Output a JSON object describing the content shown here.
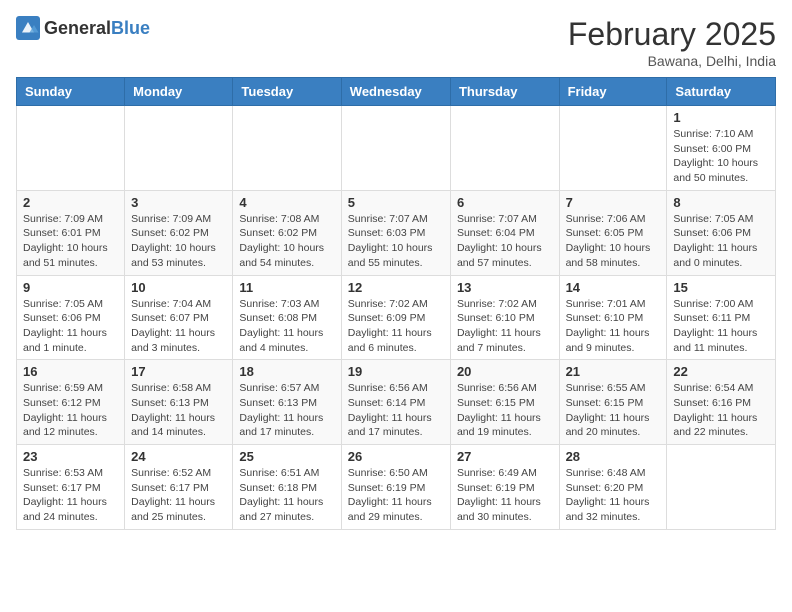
{
  "header": {
    "logo_general": "General",
    "logo_blue": "Blue",
    "month_title": "February 2025",
    "location": "Bawana, Delhi, India"
  },
  "weekdays": [
    "Sunday",
    "Monday",
    "Tuesday",
    "Wednesday",
    "Thursday",
    "Friday",
    "Saturday"
  ],
  "weeks": [
    [
      {
        "day": "",
        "info": ""
      },
      {
        "day": "",
        "info": ""
      },
      {
        "day": "",
        "info": ""
      },
      {
        "day": "",
        "info": ""
      },
      {
        "day": "",
        "info": ""
      },
      {
        "day": "",
        "info": ""
      },
      {
        "day": "1",
        "info": "Sunrise: 7:10 AM\nSunset: 6:00 PM\nDaylight: 10 hours and 50 minutes."
      }
    ],
    [
      {
        "day": "2",
        "info": "Sunrise: 7:09 AM\nSunset: 6:01 PM\nDaylight: 10 hours and 51 minutes."
      },
      {
        "day": "3",
        "info": "Sunrise: 7:09 AM\nSunset: 6:02 PM\nDaylight: 10 hours and 53 minutes."
      },
      {
        "day": "4",
        "info": "Sunrise: 7:08 AM\nSunset: 6:02 PM\nDaylight: 10 hours and 54 minutes."
      },
      {
        "day": "5",
        "info": "Sunrise: 7:07 AM\nSunset: 6:03 PM\nDaylight: 10 hours and 55 minutes."
      },
      {
        "day": "6",
        "info": "Sunrise: 7:07 AM\nSunset: 6:04 PM\nDaylight: 10 hours and 57 minutes."
      },
      {
        "day": "7",
        "info": "Sunrise: 7:06 AM\nSunset: 6:05 PM\nDaylight: 10 hours and 58 minutes."
      },
      {
        "day": "8",
        "info": "Sunrise: 7:05 AM\nSunset: 6:06 PM\nDaylight: 11 hours and 0 minutes."
      }
    ],
    [
      {
        "day": "9",
        "info": "Sunrise: 7:05 AM\nSunset: 6:06 PM\nDaylight: 11 hours and 1 minute."
      },
      {
        "day": "10",
        "info": "Sunrise: 7:04 AM\nSunset: 6:07 PM\nDaylight: 11 hours and 3 minutes."
      },
      {
        "day": "11",
        "info": "Sunrise: 7:03 AM\nSunset: 6:08 PM\nDaylight: 11 hours and 4 minutes."
      },
      {
        "day": "12",
        "info": "Sunrise: 7:02 AM\nSunset: 6:09 PM\nDaylight: 11 hours and 6 minutes."
      },
      {
        "day": "13",
        "info": "Sunrise: 7:02 AM\nSunset: 6:10 PM\nDaylight: 11 hours and 7 minutes."
      },
      {
        "day": "14",
        "info": "Sunrise: 7:01 AM\nSunset: 6:10 PM\nDaylight: 11 hours and 9 minutes."
      },
      {
        "day": "15",
        "info": "Sunrise: 7:00 AM\nSunset: 6:11 PM\nDaylight: 11 hours and 11 minutes."
      }
    ],
    [
      {
        "day": "16",
        "info": "Sunrise: 6:59 AM\nSunset: 6:12 PM\nDaylight: 11 hours and 12 minutes."
      },
      {
        "day": "17",
        "info": "Sunrise: 6:58 AM\nSunset: 6:13 PM\nDaylight: 11 hours and 14 minutes."
      },
      {
        "day": "18",
        "info": "Sunrise: 6:57 AM\nSunset: 6:13 PM\nDaylight: 11 hours and 17 minutes."
      },
      {
        "day": "19",
        "info": "Sunrise: 6:56 AM\nSunset: 6:14 PM\nDaylight: 11 hours and 17 minutes."
      },
      {
        "day": "20",
        "info": "Sunrise: 6:56 AM\nSunset: 6:15 PM\nDaylight: 11 hours and 19 minutes."
      },
      {
        "day": "21",
        "info": "Sunrise: 6:55 AM\nSunset: 6:15 PM\nDaylight: 11 hours and 20 minutes."
      },
      {
        "day": "22",
        "info": "Sunrise: 6:54 AM\nSunset: 6:16 PM\nDaylight: 11 hours and 22 minutes."
      }
    ],
    [
      {
        "day": "23",
        "info": "Sunrise: 6:53 AM\nSunset: 6:17 PM\nDaylight: 11 hours and 24 minutes."
      },
      {
        "day": "24",
        "info": "Sunrise: 6:52 AM\nSunset: 6:17 PM\nDaylight: 11 hours and 25 minutes."
      },
      {
        "day": "25",
        "info": "Sunrise: 6:51 AM\nSunset: 6:18 PM\nDaylight: 11 hours and 27 minutes."
      },
      {
        "day": "26",
        "info": "Sunrise: 6:50 AM\nSunset: 6:19 PM\nDaylight: 11 hours and 29 minutes."
      },
      {
        "day": "27",
        "info": "Sunrise: 6:49 AM\nSunset: 6:19 PM\nDaylight: 11 hours and 30 minutes."
      },
      {
        "day": "28",
        "info": "Sunrise: 6:48 AM\nSunset: 6:20 PM\nDaylight: 11 hours and 32 minutes."
      },
      {
        "day": "",
        "info": ""
      }
    ]
  ]
}
